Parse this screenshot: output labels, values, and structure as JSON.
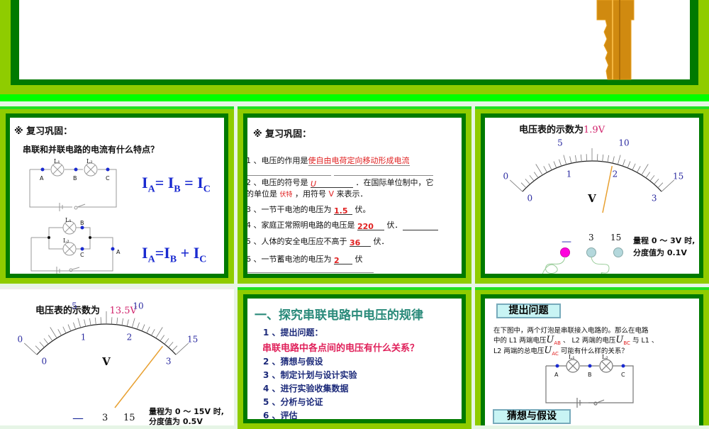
{
  "slides": [
    {
      "index": 1,
      "type": "title-slide-partial"
    },
    {
      "index": 2,
      "heading": "※ 复习巩固：",
      "question": "串联和并联电路的电流有什么特点？",
      "series_labels": {
        "l1": "L₁",
        "l2": "L₂",
        "a": "A",
        "b": "B",
        "c": "C"
      },
      "parallel_labels": {
        "l1": "L₁",
        "l2": "L₂",
        "a": "A",
        "b": "B",
        "c": "C"
      },
      "formula_series": {
        "i": "I",
        "a": "A",
        "eq": "= ",
        "b": "B",
        "eq2": " = ",
        "c": "C"
      },
      "formula_parallel": {
        "i": "I",
        "a": "A",
        "eq": "=",
        "b": "B",
        "plus": " + ",
        "c": "C"
      }
    },
    {
      "index": 3,
      "heading": "※ 复习巩固：",
      "q1": "1 、电压的作用是",
      "a1": "使自由电荷定向移动形成电流",
      "q2a": "2 、电压的符号是",
      "a2": "U",
      "q2b": "．在国际单位制中，它",
      "q2c": "的单位是",
      "a2b": "伏特",
      "q2d": "，用符号",
      "a2c": "V",
      "q2e": "来表示．",
      "q3": "3 、一节干电池的电压为",
      "a3": "1.5",
      "q3b": "伏。",
      "q4": "4 、家庭正常照明电路的电压是",
      "a4": "220",
      "q4b": "伏．",
      "q5": "5 、人体的安全电压应不高于",
      "a5": "36",
      "q5b": "伏．",
      "q6": "6 、一节蓄电池的电压为",
      "a6": "2",
      "q6b": "伏"
    },
    {
      "index": 4,
      "title": "电压表的示数为",
      "reading": "1.9V",
      "needle_value": 1.9,
      "needle_range": 3,
      "outer_ticks": [
        "0",
        "5",
        "10",
        "15"
      ],
      "inner_ticks": [
        "0",
        "1",
        "2",
        "3"
      ],
      "unit": "V",
      "terminals": [
        "—",
        "3",
        "15"
      ],
      "note1": "量程 0 ～ 3V 时,",
      "note2": "分度值为 0.1V",
      "colors": {
        "neg": "#ff00dd",
        "pos": "#b4d8dc"
      }
    },
    {
      "index": 5,
      "title": "电压表的示数为",
      "reading": "13.5V",
      "needle_value": 13.5,
      "needle_range": 15,
      "outer_ticks": [
        "0",
        "5",
        "10",
        "15"
      ],
      "inner_ticks": [
        "0",
        "1",
        "2",
        "3"
      ],
      "unit": "V",
      "terminals": [
        "—",
        "3",
        "15"
      ],
      "note1": "量程为 0 ～ 15V 时,",
      "note2": "分度值为 0.5V"
    },
    {
      "index": 6,
      "title": "一、探究串联电路中电压的规律",
      "items": [
        "1 、提出问题：",
        "串联电路中各点间的电压有什么关系？",
        "2 、猜想与假设",
        "3 、制定计划与设计实验",
        "4 、进行实验收集数据",
        "5 、分析与论证",
        "6 、评估"
      ]
    },
    {
      "index": 7,
      "box1": "提出问题",
      "p1": "在下图中，两个灯泡是串联接入电路的。那么在电路",
      "p2a": "中的 L1 两端电压",
      "uab": "U",
      "uab_sub": "AB",
      "p2b": "、 L2 两端的电压",
      "ubc": "U",
      "ubc_sub": "BC",
      "p2c": "与 L1 、",
      "p3a": "L2 两端的总电压",
      "uac": "U",
      "uac_sub": "AC",
      "p3b": "可能有什么样的关系？",
      "labels": {
        "l1": "L₁",
        "l2": "L₂",
        "a": "A",
        "b": "B",
        "c": "C"
      },
      "box2": "猜想与假设"
    }
  ]
}
